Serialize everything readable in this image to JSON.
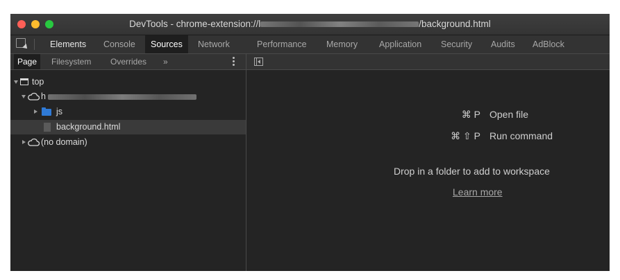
{
  "window": {
    "title_prefix": "DevTools - chrome-extension://",
    "title_host_initial": "l",
    "title_suffix": "/background.html",
    "traffic_lights": {
      "close": "#ff5f57",
      "minimize": "#febc2e",
      "zoom": "#28c840"
    }
  },
  "toolbar": {
    "inspect_icon": "inspect-element-icon",
    "tabs": [
      {
        "label": "Elements",
        "active": false
      },
      {
        "label": "Console",
        "active": false
      },
      {
        "label": "Sources",
        "active": true
      },
      {
        "label": "Network",
        "active": false
      },
      {
        "label": "Performance",
        "active": false
      },
      {
        "label": "Memory",
        "active": false
      },
      {
        "label": "Application",
        "active": false
      },
      {
        "label": "Security",
        "active": false
      },
      {
        "label": "Audits",
        "active": false
      },
      {
        "label": "AdBlock",
        "active": false
      }
    ]
  },
  "navigator": {
    "tabs": [
      {
        "label": "Page",
        "active": true
      },
      {
        "label": "Filesystem",
        "active": false
      },
      {
        "label": "Overrides",
        "active": false
      }
    ],
    "more_tabs": "»",
    "menu_icon": "kebab-menu-icon",
    "tree": {
      "top": "top",
      "origin_initial": "h",
      "js_folder": "js",
      "file": "background.html",
      "no_domain": "(no domain)"
    }
  },
  "editor": {
    "toggle_icon": "toggle-navigator-icon",
    "shortcuts": [
      {
        "keys": "⌘ P",
        "label": "Open file"
      },
      {
        "keys": "⌘ ⇧ P",
        "label": "Run command"
      }
    ],
    "drop_text": "Drop in a folder to add to workspace",
    "learn_more": "Learn more"
  }
}
